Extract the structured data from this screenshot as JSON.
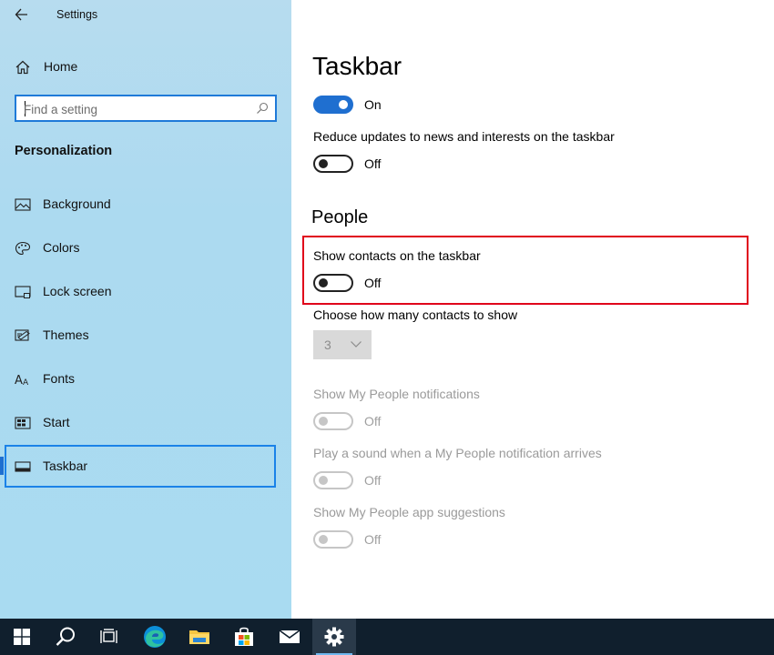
{
  "window": {
    "title": "Settings"
  },
  "sidebar": {
    "home_label": "Home",
    "search_placeholder": "Find a setting",
    "section_heading": "Personalization",
    "items": [
      {
        "label": "Background",
        "icon": "picture-icon"
      },
      {
        "label": "Colors",
        "icon": "palette-icon"
      },
      {
        "label": "Lock screen",
        "icon": "lock-screen-icon"
      },
      {
        "label": "Themes",
        "icon": "themes-icon"
      },
      {
        "label": "Fonts",
        "icon": "fonts-icon"
      },
      {
        "label": "Start",
        "icon": "start-icon"
      },
      {
        "label": "Taskbar",
        "icon": "taskbar-icon",
        "selected": true
      }
    ]
  },
  "main": {
    "title": "Taskbar",
    "top_toggle": {
      "state": "On",
      "on": true
    },
    "reduce_updates": {
      "label": "Reduce updates to news and interests on the taskbar",
      "state": "Off",
      "on": false
    },
    "people": {
      "title": "People",
      "show_contacts": {
        "label": "Show contacts on the taskbar",
        "state": "Off",
        "on": false
      },
      "contacts_count": {
        "label": "Choose how many contacts to show",
        "value": "3",
        "enabled": false
      },
      "notifications": {
        "label": "Show My People notifications",
        "state": "Off",
        "enabled": false
      },
      "sound": {
        "label": "Play a sound when a My People notification arrives",
        "state": "Off",
        "enabled": false
      },
      "suggestions": {
        "label": "Show My People app suggestions",
        "state": "Off",
        "enabled": false
      }
    }
  },
  "taskbar": {
    "buttons": [
      {
        "name": "start",
        "icon": "windows-logo-icon"
      },
      {
        "name": "search",
        "icon": "search-icon"
      },
      {
        "name": "task-view",
        "icon": "task-view-icon"
      },
      {
        "name": "edge",
        "icon": "edge-icon"
      },
      {
        "name": "file-explorer",
        "icon": "folder-icon"
      },
      {
        "name": "store",
        "icon": "store-icon"
      },
      {
        "name": "mail",
        "icon": "mail-icon"
      },
      {
        "name": "settings",
        "icon": "gear-icon",
        "active": true
      }
    ]
  },
  "colors": {
    "accent": "#1f6fd0",
    "sidebar_bg": "#acdaf0",
    "highlight_border": "#e0001a",
    "taskbar_bg": "#101f2d"
  }
}
